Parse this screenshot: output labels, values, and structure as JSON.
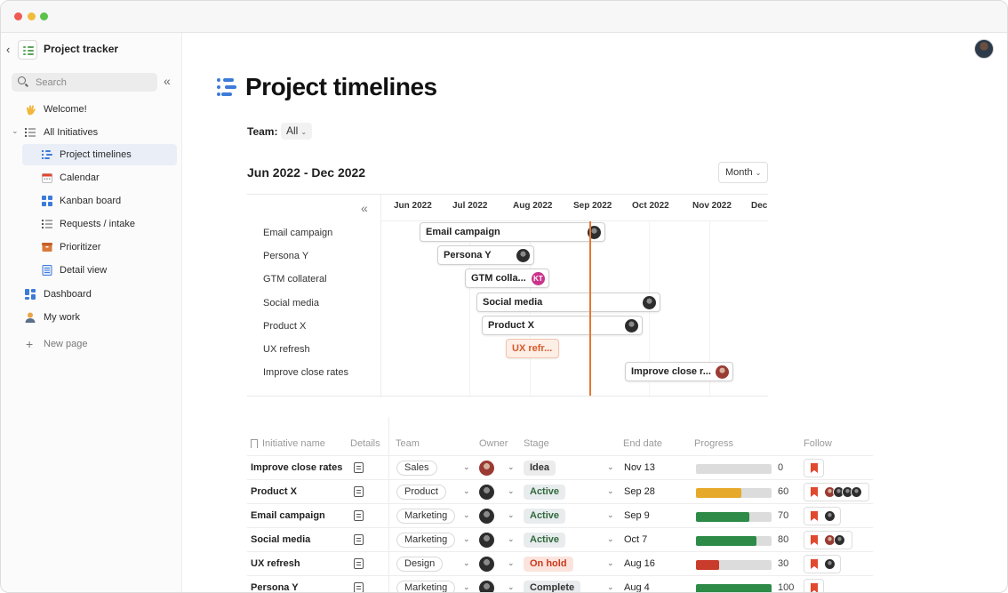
{
  "sidebar": {
    "title": "Project tracker",
    "search_placeholder": "Search",
    "items": [
      {
        "label": "Welcome!"
      },
      {
        "label": "All Initiatives"
      },
      {
        "label": "Project timelines"
      },
      {
        "label": "Calendar"
      },
      {
        "label": "Kanban board"
      },
      {
        "label": "Requests / intake"
      },
      {
        "label": "Prioritizer"
      },
      {
        "label": "Detail view"
      },
      {
        "label": "Dashboard"
      },
      {
        "label": "My work"
      }
    ],
    "new_page": "New page"
  },
  "page": {
    "title": "Project timelines",
    "team_label": "Team:",
    "team_value": "All",
    "range_title": "Jun 2022 - Dec 2022",
    "zoom_value": "Month"
  },
  "gantt": {
    "months": [
      "Jun 2022",
      "Jul 2022",
      "Aug 2022",
      "Sep 2022",
      "Oct 2022",
      "Nov 2022",
      "Dec"
    ],
    "rows": [
      {
        "label": "Email campaign",
        "bar": "Email campaign"
      },
      {
        "label": "Persona Y",
        "bar": "Persona Y"
      },
      {
        "label": "GTM collateral",
        "bar": "GTM colla...",
        "initials": "KT"
      },
      {
        "label": "Social media",
        "bar": "Social media"
      },
      {
        "label": "Product X",
        "bar": "Product X"
      },
      {
        "label": "UX refresh",
        "bar": "UX refr..."
      },
      {
        "label": "Improve close rates",
        "bar": "Improve close r..."
      }
    ]
  },
  "table": {
    "headers": {
      "name": "Initiative name",
      "details": "Details",
      "team": "Team",
      "owner": "Owner",
      "stage": "Stage",
      "end_date": "End date",
      "progress": "Progress",
      "follow": "Follow"
    },
    "rows": [
      {
        "name": "Improve close rates",
        "team": "Sales",
        "stage": "Idea",
        "end_date": "Nov 13",
        "progress": 0,
        "progress_label": "0",
        "progress_color": "#cccccc"
      },
      {
        "name": "Product X",
        "team": "Product",
        "stage": "Active",
        "end_date": "Sep 28",
        "progress": 60,
        "progress_label": "60",
        "progress_color": "#e6a92a"
      },
      {
        "name": "Email campaign",
        "team": "Marketing",
        "stage": "Active",
        "end_date": "Sep 9",
        "progress": 70,
        "progress_label": "70",
        "progress_color": "#2e8b47"
      },
      {
        "name": "Social media",
        "team": "Marketing",
        "stage": "Active",
        "end_date": "Oct 7",
        "progress": 80,
        "progress_label": "80",
        "progress_color": "#2e8b47"
      },
      {
        "name": "UX refresh",
        "team": "Design",
        "stage": "On hold",
        "end_date": "Aug 16",
        "progress": 30,
        "progress_label": "30",
        "progress_color": "#c93b2a"
      },
      {
        "name": "Persona Y",
        "team": "Marketing",
        "stage": "Complete",
        "end_date": "Aug 4",
        "progress": 100,
        "progress_label": "100",
        "progress_color": "#2e8b47"
      }
    ]
  },
  "colors": {
    "accent_blue": "#3d7bd8",
    "today_line": "#e57733",
    "flag_red": "#e2472f"
  }
}
